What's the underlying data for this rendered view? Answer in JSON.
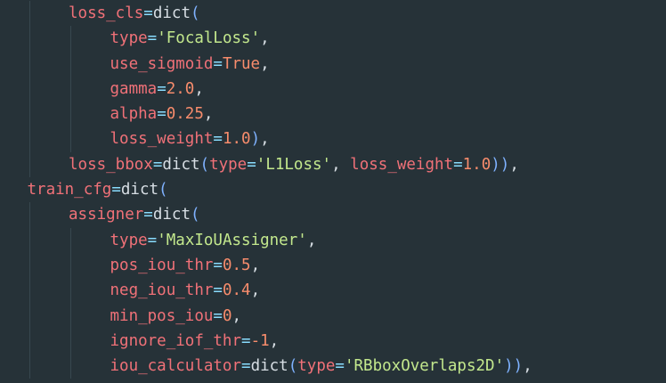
{
  "editor": {
    "lines": [
      {
        "indent": 2,
        "tokens": [
          {
            "t": "key",
            "v": "loss_cls"
          },
          {
            "t": "op",
            "v": "="
          },
          {
            "t": "func",
            "v": "dict"
          },
          {
            "t": "paren",
            "v": "("
          }
        ]
      },
      {
        "indent": 3,
        "tokens": [
          {
            "t": "key",
            "v": "type"
          },
          {
            "t": "op",
            "v": "="
          },
          {
            "t": "quote",
            "v": "'"
          },
          {
            "t": "str",
            "v": "FocalLoss"
          },
          {
            "t": "quote",
            "v": "'"
          },
          {
            "t": "punct",
            "v": ","
          }
        ]
      },
      {
        "indent": 3,
        "tokens": [
          {
            "t": "key",
            "v": "use_sigmoid"
          },
          {
            "t": "op",
            "v": "="
          },
          {
            "t": "bool",
            "v": "True"
          },
          {
            "t": "punct",
            "v": ","
          }
        ]
      },
      {
        "indent": 3,
        "tokens": [
          {
            "t": "key",
            "v": "gamma"
          },
          {
            "t": "op",
            "v": "="
          },
          {
            "t": "num",
            "v": "2.0"
          },
          {
            "t": "punct",
            "v": ","
          }
        ]
      },
      {
        "indent": 3,
        "tokens": [
          {
            "t": "key",
            "v": "alpha"
          },
          {
            "t": "op",
            "v": "="
          },
          {
            "t": "num",
            "v": "0.25"
          },
          {
            "t": "punct",
            "v": ","
          }
        ]
      },
      {
        "indent": 3,
        "tokens": [
          {
            "t": "key",
            "v": "loss_weight"
          },
          {
            "t": "op",
            "v": "="
          },
          {
            "t": "num",
            "v": "1.0"
          },
          {
            "t": "paren",
            "v": ")"
          },
          {
            "t": "punct",
            "v": ","
          }
        ]
      },
      {
        "indent": 2,
        "tokens": [
          {
            "t": "key",
            "v": "loss_bbox"
          },
          {
            "t": "op",
            "v": "="
          },
          {
            "t": "func",
            "v": "dict"
          },
          {
            "t": "paren",
            "v": "("
          },
          {
            "t": "key",
            "v": "type"
          },
          {
            "t": "op",
            "v": "="
          },
          {
            "t": "quote",
            "v": "'"
          },
          {
            "t": "str",
            "v": "L1Loss"
          },
          {
            "t": "quote",
            "v": "'"
          },
          {
            "t": "punct",
            "v": ", "
          },
          {
            "t": "key",
            "v": "loss_weight"
          },
          {
            "t": "op",
            "v": "="
          },
          {
            "t": "num",
            "v": "1.0"
          },
          {
            "t": "paren",
            "v": "))"
          },
          {
            "t": "punct",
            "v": ","
          }
        ]
      },
      {
        "indent": 1,
        "tokens": [
          {
            "t": "key",
            "v": "train_cfg"
          },
          {
            "t": "op",
            "v": "="
          },
          {
            "t": "func",
            "v": "dict"
          },
          {
            "t": "paren",
            "v": "("
          }
        ]
      },
      {
        "indent": 2,
        "tokens": [
          {
            "t": "key",
            "v": "assigner"
          },
          {
            "t": "op",
            "v": "="
          },
          {
            "t": "func",
            "v": "dict"
          },
          {
            "t": "paren",
            "v": "("
          }
        ]
      },
      {
        "indent": 3,
        "tokens": [
          {
            "t": "key",
            "v": "type"
          },
          {
            "t": "op",
            "v": "="
          },
          {
            "t": "quote",
            "v": "'"
          },
          {
            "t": "str",
            "v": "MaxIoUAssigner"
          },
          {
            "t": "quote",
            "v": "'"
          },
          {
            "t": "punct",
            "v": ","
          }
        ]
      },
      {
        "indent": 3,
        "tokens": [
          {
            "t": "key",
            "v": "pos_iou_thr"
          },
          {
            "t": "op",
            "v": "="
          },
          {
            "t": "num",
            "v": "0.5"
          },
          {
            "t": "punct",
            "v": ","
          }
        ]
      },
      {
        "indent": 3,
        "tokens": [
          {
            "t": "key",
            "v": "neg_iou_thr"
          },
          {
            "t": "op",
            "v": "="
          },
          {
            "t": "num",
            "v": "0.4"
          },
          {
            "t": "punct",
            "v": ","
          }
        ]
      },
      {
        "indent": 3,
        "tokens": [
          {
            "t": "key",
            "v": "min_pos_iou"
          },
          {
            "t": "op",
            "v": "="
          },
          {
            "t": "num",
            "v": "0"
          },
          {
            "t": "punct",
            "v": ","
          }
        ]
      },
      {
        "indent": 3,
        "tokens": [
          {
            "t": "key",
            "v": "ignore_iof_thr"
          },
          {
            "t": "op",
            "v": "="
          },
          {
            "t": "num",
            "v": "-1"
          },
          {
            "t": "punct",
            "v": ","
          }
        ]
      },
      {
        "indent": 3,
        "tokens": [
          {
            "t": "key",
            "v": "iou_calculator"
          },
          {
            "t": "op",
            "v": "="
          },
          {
            "t": "func",
            "v": "dict"
          },
          {
            "t": "paren",
            "v": "("
          },
          {
            "t": "key",
            "v": "type"
          },
          {
            "t": "op",
            "v": "="
          },
          {
            "t": "quote",
            "v": "'"
          },
          {
            "t": "str",
            "v": "RBboxOverlaps2D"
          },
          {
            "t": "quote",
            "v": "'"
          },
          {
            "t": "paren",
            "v": "))"
          },
          {
            "t": "punct",
            "v": ","
          }
        ]
      }
    ]
  },
  "colors": {
    "background": "#263238",
    "key": "#f07178",
    "operator": "#89ddff",
    "string": "#c3e88d",
    "number": "#f78c6c",
    "paren": "#7fb2ff",
    "plain": "#d7dee4",
    "indent_guide": "#37474f"
  }
}
